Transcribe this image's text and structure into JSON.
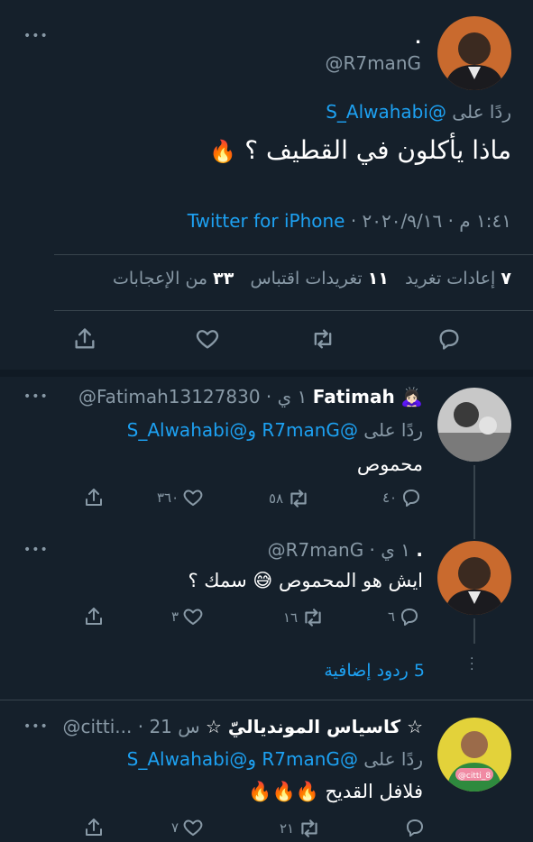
{
  "main_tweet": {
    "display_name": ".",
    "handle": "@R7manG",
    "reply_to_prefix": "ردًا على",
    "reply_to_handle": "@S_Alwahabi",
    "text": "ماذا يأكلون في القطيف ؟",
    "emoji": "🔥",
    "date_time": "١:٤١ م · ٢٠٢٠/٩/١٦ ·",
    "source": "Twitter for iPhone",
    "stats": {
      "retweets_count": "٧",
      "retweets_label": "إعادات تغريد",
      "quotes_count": "١١",
      "quotes_label": "تغريدات اقتباس",
      "likes_count": "٣٣",
      "likes_label": "من الإعجابات"
    }
  },
  "replies": [
    {
      "display_name": "Fatimah",
      "name_emoji": "🙇🏻‍♀️",
      "handle_time": "@Fatimah13127830 · ١ ي",
      "reply_prefix": "ردًا على",
      "reply_handles": "@R7manG و@S_Alwahabi",
      "text": "محموص",
      "replies_count": "٤٠",
      "retweets_count": "٥٨",
      "likes_count": "٣٦٠"
    },
    {
      "display_name": ".",
      "handle_time": "@R7manG · ١ ي",
      "text": "ايش هو المحموص 😅 سمك ؟",
      "replies_count": "٦",
      "retweets_count": "١٦",
      "likes_count": "٣"
    },
    {
      "display_name": "☆ كاسياس الموندياليّ ☆",
      "handle_time": "@citti... · 21 س",
      "reply_prefix": "ردًا على",
      "reply_handles": "@R7manG و@S_Alwahabi",
      "text": "فلافل القديح 🔥🔥🔥",
      "avatar_caption": "@citti_8",
      "replies_count": "",
      "retweets_count": "٢١",
      "likes_count": "٧"
    }
  ],
  "more_replies_label": "5 ردود إضافية",
  "icons": {
    "more": "more-dots-icon",
    "share": "share-icon",
    "like": "heart-icon",
    "retweet": "retweet-icon",
    "reply": "reply-bubble-icon"
  }
}
